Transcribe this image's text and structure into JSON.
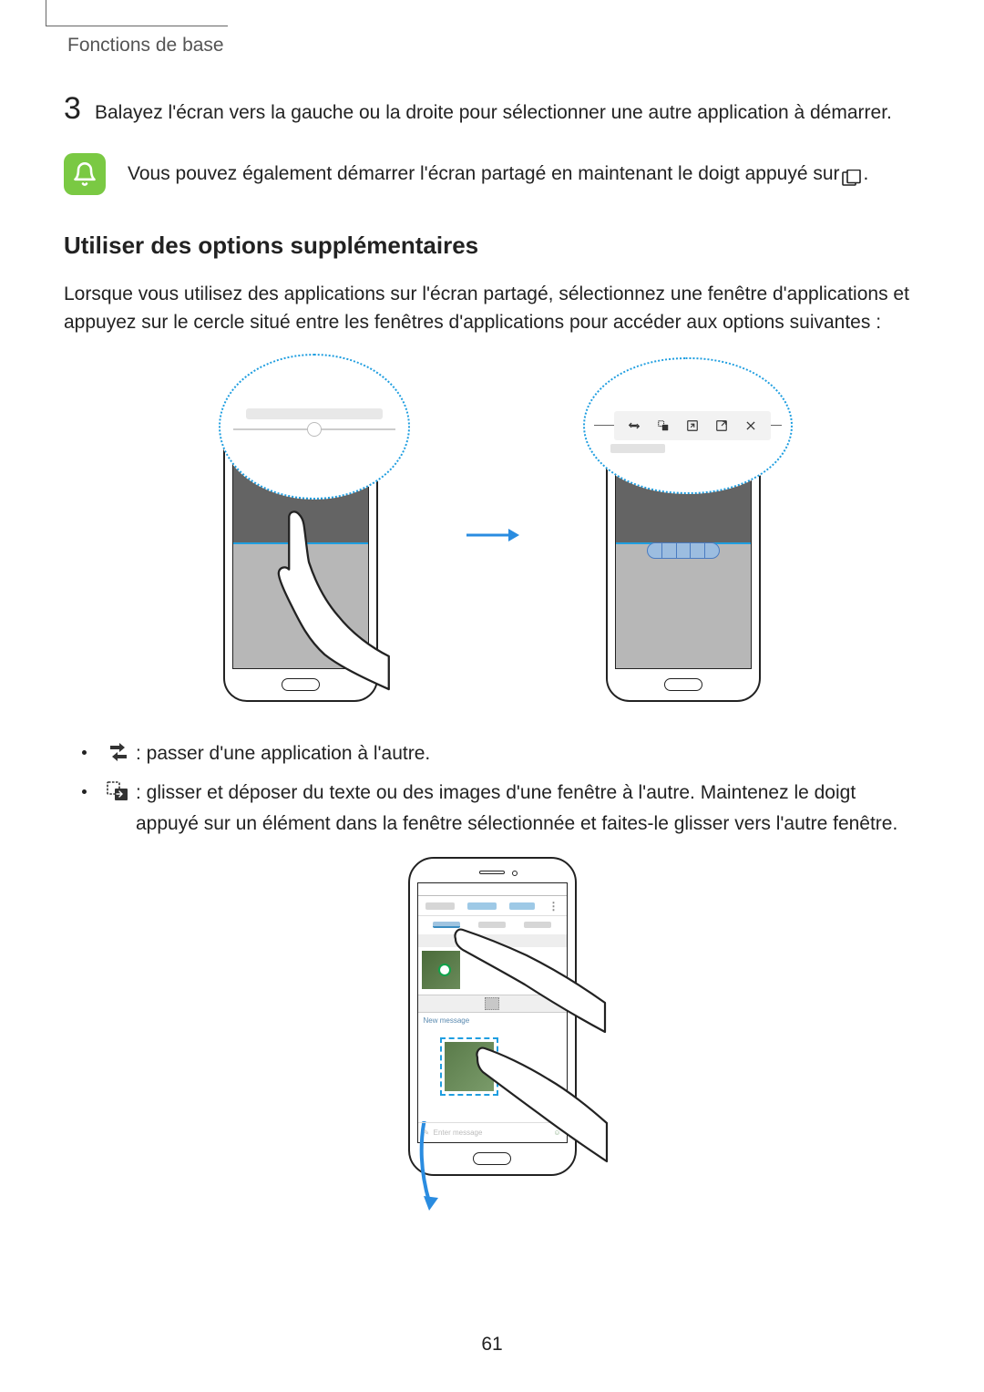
{
  "header": {
    "breadcrumb": "Fonctions de base"
  },
  "step": {
    "number": "3",
    "text": "Balayez l'écran vers la gauche ou la droite pour sélectionner une autre application à démarrer."
  },
  "note": {
    "text_before": "Vous pouvez également démarrer l'écran partagé en maintenant le doigt appuyé sur ",
    "text_after": "."
  },
  "section": {
    "heading": "Utiliser des options supplémentaires",
    "body": "Lorsque vous utilisez des applications sur l'écran partagé, sélectionnez une fenêtre d'applications et appuyez sur le cercle situé entre les fenêtres d'applications pour accéder aux options suivantes :"
  },
  "bullets": {
    "item1": " : passer d'une application à l'autre.",
    "item2": " : glisser et déposer du texte ou des images d'une fenêtre à l'autre. Maintenez le doigt appuyé sur un élément dans la fenêtre sélectionnée et faites-le glisser vers l'autre fenêtre."
  },
  "toolbar_icons": {
    "i1": "swap-icon",
    "i2": "drag-drop-icon",
    "i3": "expand-icon",
    "i4": "popup-icon",
    "i5": "close-icon"
  },
  "page_number": "61"
}
